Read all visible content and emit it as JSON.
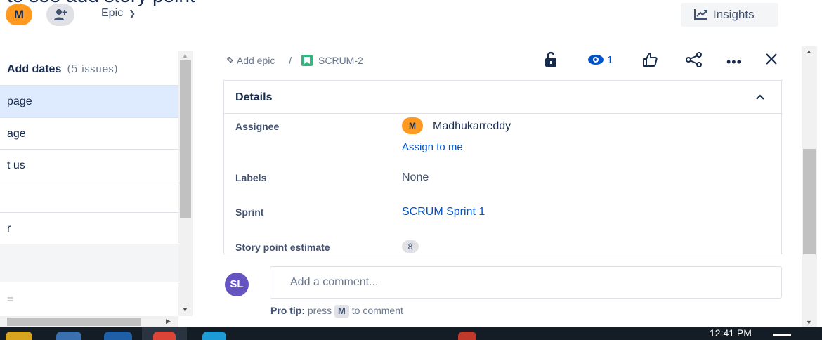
{
  "header": {
    "cut_title": "to see add story point",
    "user_initial": "M",
    "epic_filter_label": "Epic",
    "insights_label": "Insights"
  },
  "left_panel": {
    "header_label": "Add dates",
    "header_count": "(5 issues)",
    "rows": [
      {
        "text": "page",
        "selected": true
      },
      {
        "text": "age",
        "selected": false
      },
      {
        "text": "t us",
        "selected": false
      },
      {
        "text": "",
        "selected": false
      },
      {
        "text": "r",
        "selected": false
      },
      {
        "text": "",
        "selected": false,
        "shaded": true
      },
      {
        "text": "=",
        "selected": false
      }
    ]
  },
  "issue": {
    "breadcrumb_add_epic": "Add epic",
    "breadcrumb_sep": "/",
    "issue_key": "SCRUM-2",
    "watch_count": "1"
  },
  "details": {
    "title": "Details",
    "assignee_label": "Assignee",
    "assignee_initial": "M",
    "assignee_name": "Madhukarreddy",
    "assign_to_me": "Assign to me",
    "labels_label": "Labels",
    "labels_value": "None",
    "sprint_label": "Sprint",
    "sprint_value": "SCRUM Sprint 1",
    "story_points_label": "Story point estimate",
    "story_points_value": "8"
  },
  "comment": {
    "avatar_initials": "SL",
    "placeholder": "Add a comment...",
    "pro_tip_label": "Pro tip:",
    "pro_tip_press": "press",
    "pro_tip_key": "M",
    "pro_tip_suffix": "to comment"
  },
  "taskbar": {
    "clock": "12:41 PM"
  },
  "colors": {
    "brand_blue": "#0052cc",
    "selected_row": "#deebff",
    "assignee_avatar": "#ff991f",
    "comment_avatar": "#6554c0",
    "story_icon": "#36b37e"
  }
}
